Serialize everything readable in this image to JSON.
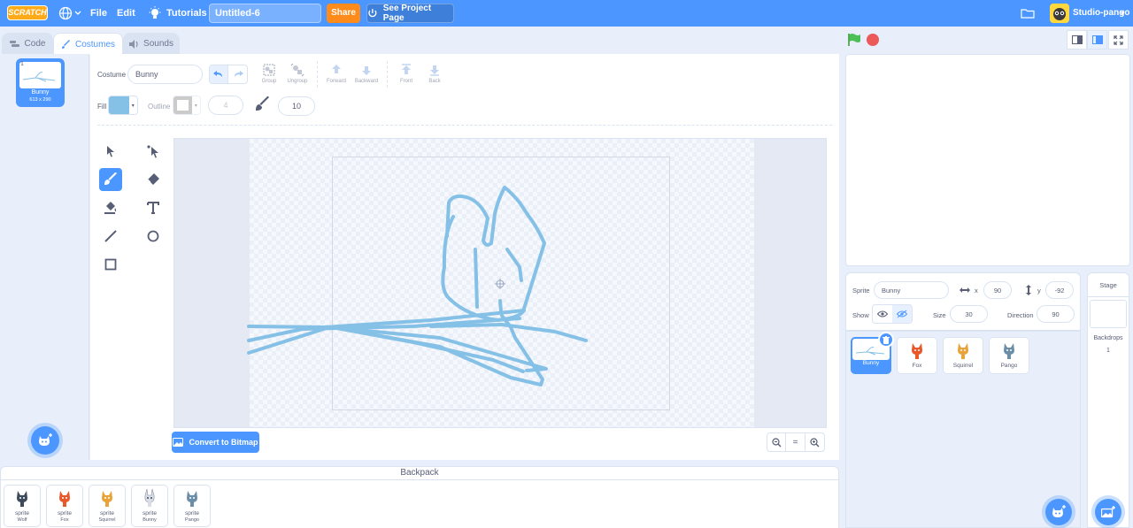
{
  "menubar": {
    "logo_text": "SCRATCH",
    "file": "File",
    "edit": "Edit",
    "tutorials": "Tutorials",
    "project_title": "Untitled-6",
    "share": "Share",
    "see_project_page": "See Project Page",
    "username": "Studio-pango",
    "brand_color": "#4c97ff"
  },
  "tabs": {
    "code": "Code",
    "costumes": "Costumes",
    "sounds": "Sounds"
  },
  "costume_list": {
    "items": [
      {
        "number": "1",
        "name": "Bunny",
        "size": "613 x 290"
      }
    ]
  },
  "paint_editor": {
    "costume_label": "Costume",
    "costume_name": "Bunny",
    "toolbar": {
      "group": "Group",
      "ungroup": "Ungroup",
      "forward": "Forward",
      "backward": "Backward",
      "front": "Front",
      "back": "Back"
    },
    "fill_label": "Fill",
    "fill_color": "#85c0e6",
    "outline_label": "Outline",
    "outline_width": "4",
    "brush_size": "10",
    "convert_button": "Convert to Bitmap",
    "zoom_reset": "="
  },
  "backpack": {
    "title": "Backpack",
    "items": [
      {
        "type": "sprite",
        "name": "Wolf"
      },
      {
        "type": "sprite",
        "name": "Fox"
      },
      {
        "type": "sprite",
        "name": "Squirrel"
      },
      {
        "type": "sprite",
        "name": "Bunny"
      },
      {
        "type": "sprite",
        "name": "Pango"
      }
    ]
  },
  "sprite_info": {
    "sprite_label": "Sprite",
    "sprite_name": "Bunny",
    "x_label": "x",
    "x_value": "90",
    "y_label": "y",
    "y_value": "-92",
    "show_label": "Show",
    "size_label": "Size",
    "size_value": "30",
    "direction_label": "Direction",
    "direction_value": "90"
  },
  "sprites": [
    {
      "name": "Bunny",
      "selected": true
    },
    {
      "name": "Fox"
    },
    {
      "name": "Squirrel"
    },
    {
      "name": "Pango"
    }
  ],
  "stage_pane": {
    "title": "Stage",
    "backdrops_label": "Backdrops",
    "backdrops_count": "1"
  }
}
